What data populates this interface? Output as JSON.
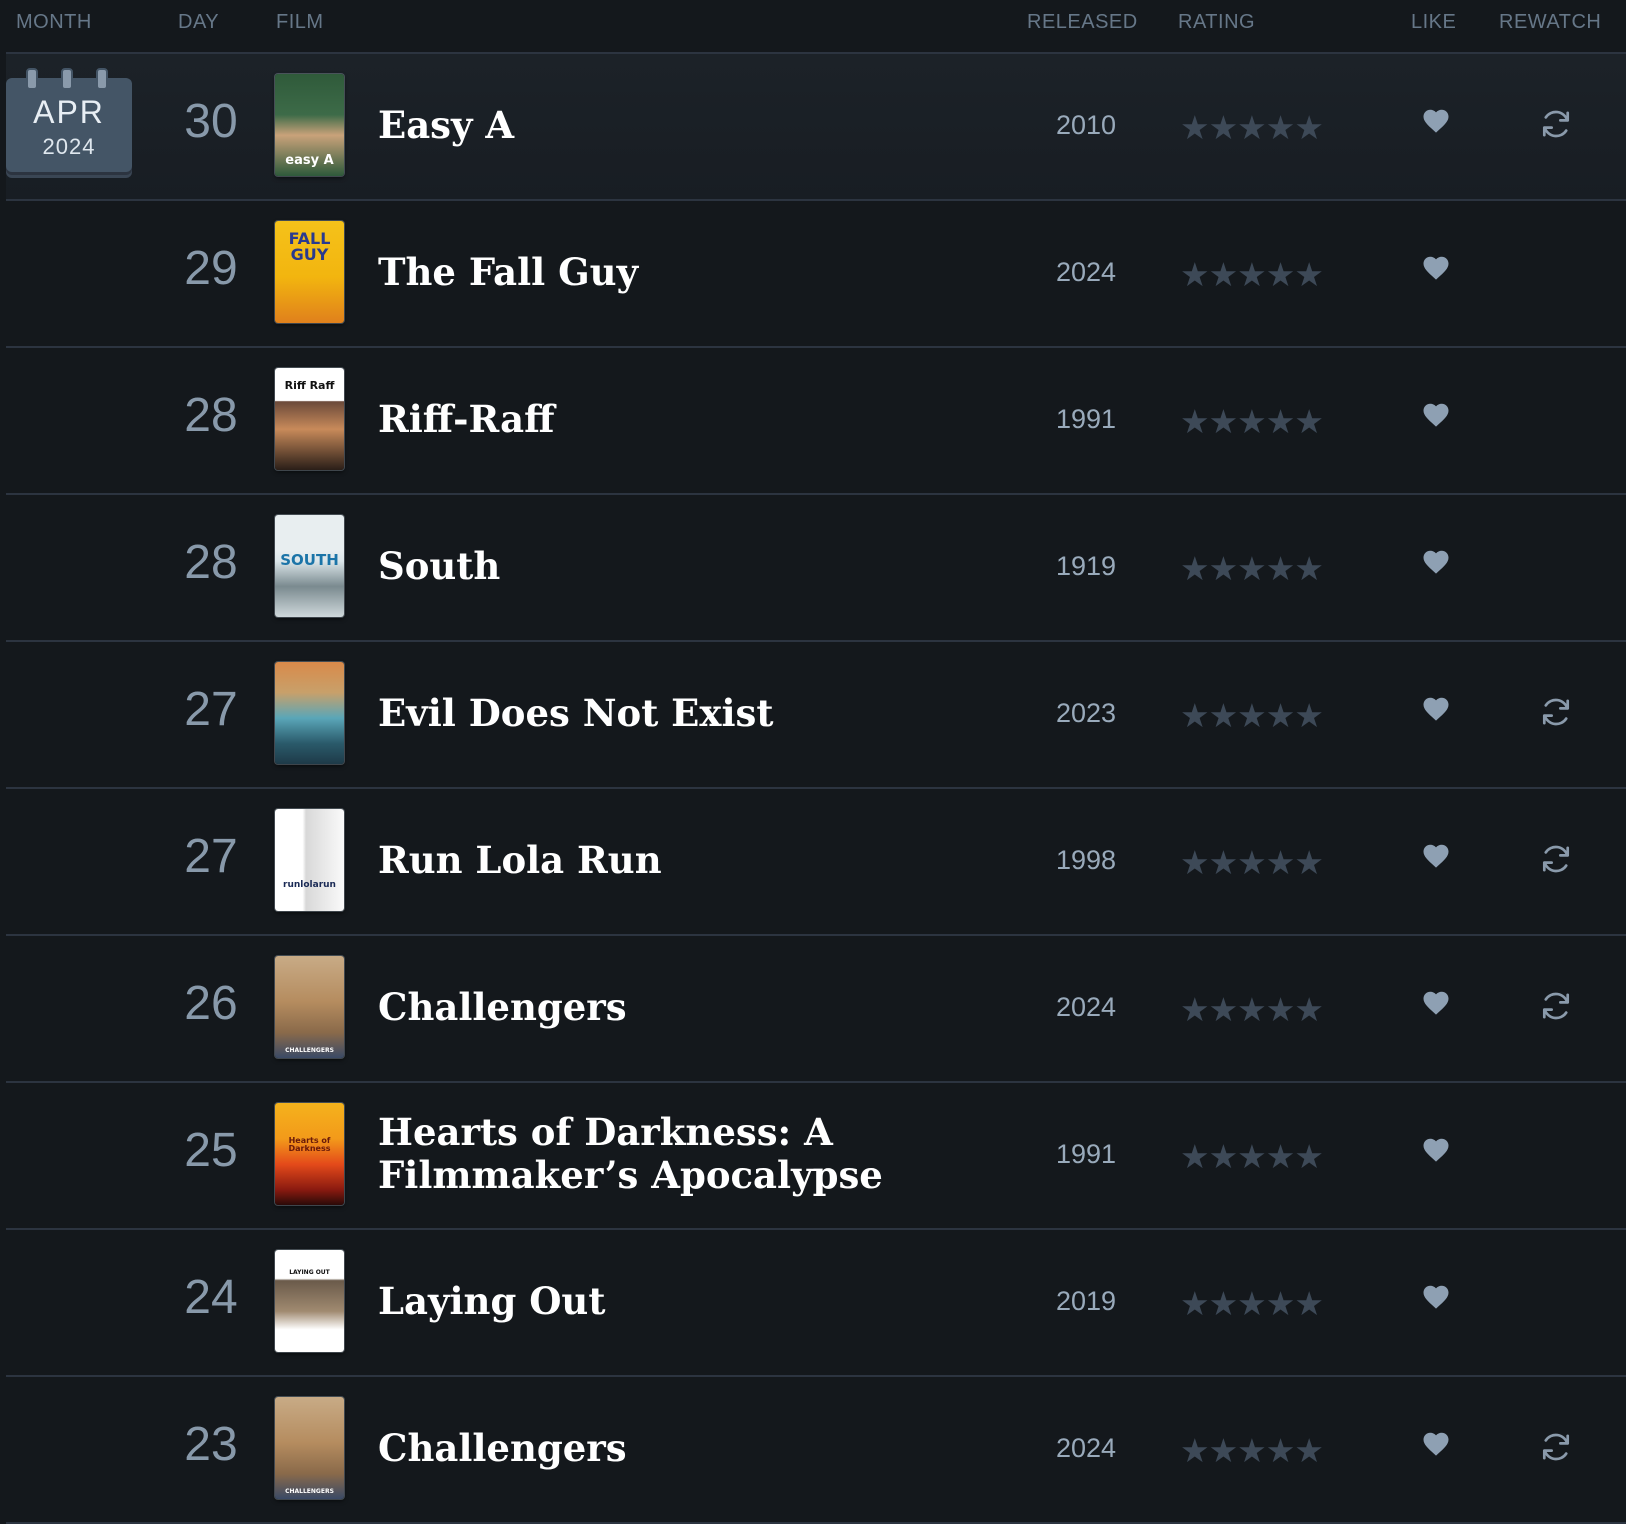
{
  "header": {
    "month": "MONTH",
    "day": "DAY",
    "film": "FILM",
    "released": "RELEASED",
    "rating": "RATING",
    "like": "LIKE",
    "rewatch": "REWATCH"
  },
  "month_badge": {
    "month": "APR",
    "year": "2024"
  },
  "colors": {
    "background": "#14181c",
    "divider": "#2c3440",
    "star_empty": "#3d4957",
    "like_heart": "#8ea0b3",
    "rewatch_icon": "#8a9aab"
  },
  "entries": [
    {
      "day": "30",
      "title": "Easy A",
      "released": "2010",
      "stars": "★★★★★",
      "liked": true,
      "rewatch": true,
      "poster_text": "easy A",
      "poster_style": "easy-a"
    },
    {
      "day": "29",
      "title": "The Fall Guy",
      "released": "2024",
      "stars": "★★★★★",
      "liked": true,
      "rewatch": false,
      "poster_text": "FALL GUY",
      "poster_style": "fall-guy"
    },
    {
      "day": "28",
      "title": "Riff-Raff",
      "released": "1991",
      "stars": "★★★★★",
      "liked": true,
      "rewatch": false,
      "poster_text": "Riff Raff",
      "poster_style": "riff-raff"
    },
    {
      "day": "28",
      "title": "South",
      "released": "1919",
      "stars": "★★★★★",
      "liked": true,
      "rewatch": false,
      "poster_text": "SOUTH",
      "poster_style": "south"
    },
    {
      "day": "27",
      "title": "Evil Does Not Exist",
      "released": "2023",
      "stars": "★★★★★",
      "liked": true,
      "rewatch": true,
      "poster_text": "",
      "poster_style": "evil"
    },
    {
      "day": "27",
      "title": "Run Lola Run",
      "released": "1998",
      "stars": "★★★★★",
      "liked": true,
      "rewatch": true,
      "poster_text": "runlolarun",
      "poster_style": "lola"
    },
    {
      "day": "26",
      "title": "Challengers",
      "released": "2024",
      "stars": "★★★★★",
      "liked": true,
      "rewatch": true,
      "poster_text": "CHALLENGERS",
      "poster_style": "challengers"
    },
    {
      "day": "25",
      "title": "Hearts of Darkness: A Filmmaker’s Apocalypse",
      "title_line1": "Hearts of Darkness: A",
      "title_line2": "Filmmaker’s Apocalypse",
      "released": "1991",
      "stars": "★★★★★",
      "liked": true,
      "rewatch": false,
      "poster_text": "Hearts of Darkness",
      "poster_style": "hearts"
    },
    {
      "day": "24",
      "title": "Laying Out",
      "released": "2019",
      "stars": "★★★★★",
      "liked": true,
      "rewatch": false,
      "poster_text": "LAYING OUT",
      "poster_style": "laying"
    },
    {
      "day": "23",
      "title": "Challengers",
      "released": "2024",
      "stars": "★★★★★",
      "liked": true,
      "rewatch": true,
      "poster_text": "CHALLENGERS",
      "poster_style": "challengers"
    }
  ]
}
